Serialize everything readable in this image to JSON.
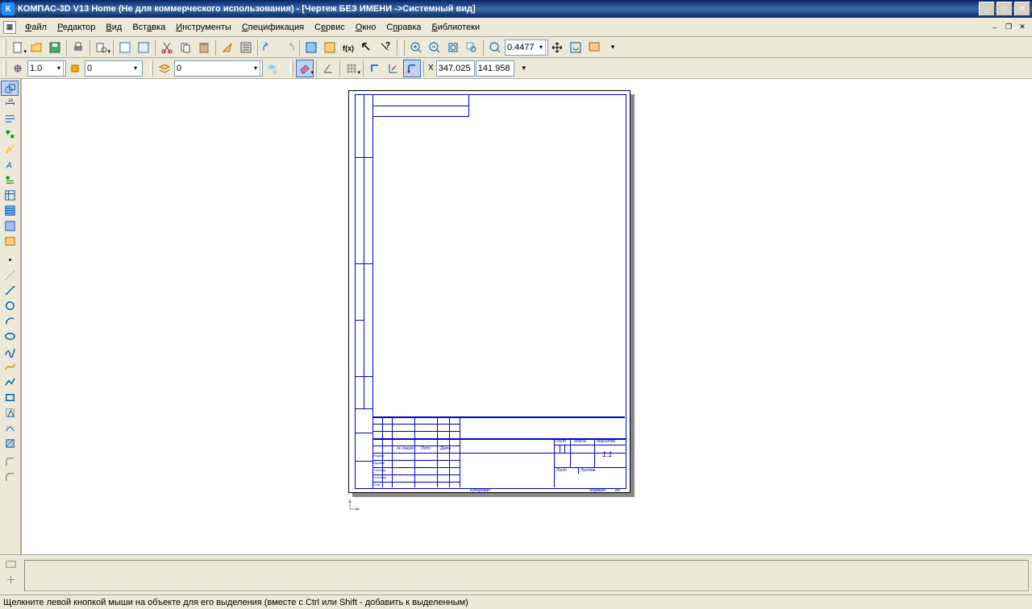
{
  "title": "КОМПАС-3D V13 Home (Не для коммерческого использования) - [Чертеж БЕЗ ИМЕНИ ->Системный вид]",
  "menu": {
    "file": "Файл",
    "editor": "Редактор",
    "view": "Вид",
    "insert": "Вставка",
    "tools": "Инструменты",
    "spec": "Спецификация",
    "service": "Сервис",
    "window": "Окно",
    "help": "Справка",
    "libs": "Библиотеки"
  },
  "toolbar1": {
    "zoom_value": "0.4477"
  },
  "toolbar2": {
    "step_value": "1.0",
    "style_value": "0",
    "layer_value": "0",
    "coord_x": "347.025",
    "coord_y": "141.958"
  },
  "titleblock": {
    "scale": "1:1",
    "list": "Лист",
    "mass": "Масса",
    "scale_lbl": "Масштаб",
    "listov": "Листов",
    "n_doc": "№ докум.",
    "podp": "Подп.",
    "data": "Дата",
    "izm": "Изм",
    "kopiroval": "Копировал",
    "format": "Формат",
    "a4": "А4",
    "razrab": "Разраб",
    "prov": "Провер",
    "tkontr": "Т.Контр",
    "nkontr": "Н.Контр",
    "utv": "Утв"
  },
  "status": "Щелкните левой кнопкой мыши на объекте для его выделения (вместе с Ctrl или Shift - добавить к выделенным)"
}
